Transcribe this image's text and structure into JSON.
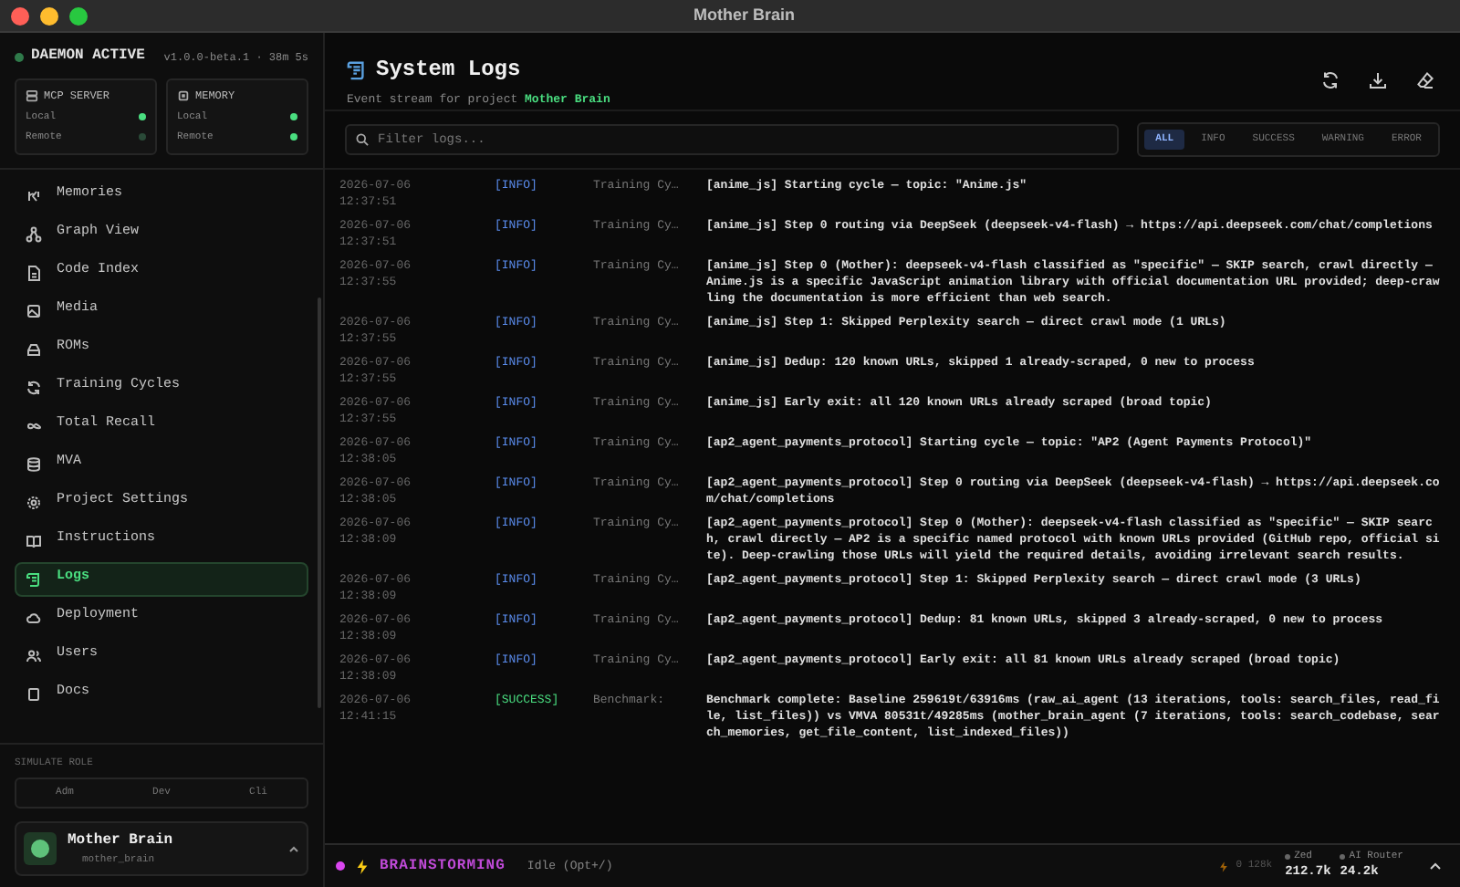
{
  "window": {
    "title": "Mother Brain"
  },
  "sidebar": {
    "status": "DAEMON ACTIVE",
    "version": "v1.0.0-beta.1 · 38m 5s",
    "cards": [
      {
        "title": "MCP SERVER",
        "rows": [
          {
            "label": "Local",
            "on": true
          },
          {
            "label": "Remote",
            "on": false
          }
        ]
      },
      {
        "title": "MEMORY",
        "rows": [
          {
            "label": "Local",
            "on": true
          },
          {
            "label": "Remote",
            "on": true
          }
        ]
      }
    ],
    "items": [
      {
        "label": "Memories",
        "selected": false
      },
      {
        "label": "Graph View",
        "selected": false
      },
      {
        "label": "Code Index",
        "selected": false
      },
      {
        "label": "Media",
        "selected": false
      },
      {
        "label": "ROMs",
        "selected": false
      },
      {
        "label": "Training Cycles",
        "selected": false
      },
      {
        "label": "Total Recall",
        "selected": false
      },
      {
        "label": "MVA",
        "selected": false
      },
      {
        "label": "Project Settings",
        "selected": false
      },
      {
        "label": "Instructions",
        "selected": false
      },
      {
        "label": "Logs",
        "selected": true
      },
      {
        "label": "Deployment",
        "selected": false
      },
      {
        "label": "Users",
        "selected": false
      },
      {
        "label": "Docs",
        "selected": false
      }
    ],
    "simulate_role": {
      "label": "SIMULATE ROLE",
      "options": [
        "Adm",
        "Dev",
        "Cli"
      ]
    },
    "user": {
      "name": "Mother Brain",
      "handle": "mother_brain"
    }
  },
  "header": {
    "title": "System Logs",
    "subtitle_prefix": "Event stream for project",
    "project": "Mother Brain"
  },
  "filter": {
    "placeholder": "Filter logs...",
    "levels": [
      {
        "label": "ALL",
        "selected": true
      },
      {
        "label": "INFO",
        "selected": false
      },
      {
        "label": "SUCCESS",
        "selected": false
      },
      {
        "label": "WARNING",
        "selected": false
      },
      {
        "label": "ERROR",
        "selected": false
      }
    ]
  },
  "logs": [
    {
      "date": "2026-07-06",
      "time": "12:37:51",
      "level": "[INFO]",
      "kind": "info",
      "source": "Training Cy…",
      "message": "[anime_js] Starting cycle — topic: \"Anime.js\""
    },
    {
      "date": "2026-07-06",
      "time": "12:37:51",
      "level": "[INFO]",
      "kind": "info",
      "source": "Training Cy…",
      "message": "[anime_js] Step 0 routing via DeepSeek (deepseek-v4-flash) → https://api.deepseek.com/chat/completions"
    },
    {
      "date": "2026-07-06",
      "time": "12:37:55",
      "level": "[INFO]",
      "kind": "info",
      "source": "Training Cy…",
      "message": "[anime_js] Step 0 (Mother): deepseek-v4-flash classified as \"specific\" — SKIP search, crawl directly — Anime.js is a specific JavaScript animation library with official documentation URL provided; deep-crawling the documentation is more efficient than web search."
    },
    {
      "date": "2026-07-06",
      "time": "12:37:55",
      "level": "[INFO]",
      "kind": "info",
      "source": "Training Cy…",
      "message": "[anime_js] Step 1: Skipped Perplexity search — direct crawl mode (1 URLs)"
    },
    {
      "date": "2026-07-06",
      "time": "12:37:55",
      "level": "[INFO]",
      "kind": "info",
      "source": "Training Cy…",
      "message": "[anime_js] Dedup: 120 known URLs, skipped 1 already-scraped, 0 new to process"
    },
    {
      "date": "2026-07-06",
      "time": "12:37:55",
      "level": "[INFO]",
      "kind": "info",
      "source": "Training Cy…",
      "message": "[anime_js] Early exit: all 120 known URLs already scraped (broad topic)"
    },
    {
      "date": "2026-07-06",
      "time": "12:38:05",
      "level": "[INFO]",
      "kind": "info",
      "source": "Training Cy…",
      "message": "[ap2_agent_payments_protocol] Starting cycle — topic: \"AP2 (Agent Payments Protocol)\""
    },
    {
      "date": "2026-07-06",
      "time": "12:38:05",
      "level": "[INFO]",
      "kind": "info",
      "source": "Training Cy…",
      "message": "[ap2_agent_payments_protocol] Step 0 routing via DeepSeek (deepseek-v4-flash) → https://api.deepseek.com/chat/completions"
    },
    {
      "date": "2026-07-06",
      "time": "12:38:09",
      "level": "[INFO]",
      "kind": "info",
      "source": "Training Cy…",
      "message": "[ap2_agent_payments_protocol] Step 0 (Mother): deepseek-v4-flash classified as \"specific\" — SKIP search, crawl directly — AP2 is a specific named protocol with known URLs provided (GitHub repo, official site). Deep-crawling those URLs will yield the required details, avoiding irrelevant search results."
    },
    {
      "date": "2026-07-06",
      "time": "12:38:09",
      "level": "[INFO]",
      "kind": "info",
      "source": "Training Cy…",
      "message": "[ap2_agent_payments_protocol] Step 1: Skipped Perplexity search — direct crawl mode (3 URLs)"
    },
    {
      "date": "2026-07-06",
      "time": "12:38:09",
      "level": "[INFO]",
      "kind": "info",
      "source": "Training Cy…",
      "message": "[ap2_agent_payments_protocol] Dedup: 81 known URLs, skipped 3 already-scraped, 0 new to process"
    },
    {
      "date": "2026-07-06",
      "time": "12:38:09",
      "level": "[INFO]",
      "kind": "info",
      "source": "Training Cy…",
      "message": "[ap2_agent_payments_protocol] Early exit: all 81 known URLs already scraped (broad topic)"
    },
    {
      "date": "2026-07-06",
      "time": "12:41:15",
      "level": "[SUCCESS]",
      "kind": "success",
      "source": "Benchmark:",
      "message": "Benchmark complete: Baseline 259619t/63916ms (raw_ai_agent (13 iterations, tools: search_files, read_file, list_files)) vs VMVA 80531t/49285ms (mother_brain_agent (7 iterations, tools: search_codebase, search_memories, get_file_content, list_indexed_files))"
    }
  ],
  "status_bar": {
    "mode": "BRAINSTORMING",
    "state": "Idle (Opt+/)",
    "tokens": "0 128k",
    "meters": [
      {
        "label": "Zed",
        "value": "212.7k"
      },
      {
        "label": "AI Router",
        "value": "24.2k"
      }
    ]
  }
}
